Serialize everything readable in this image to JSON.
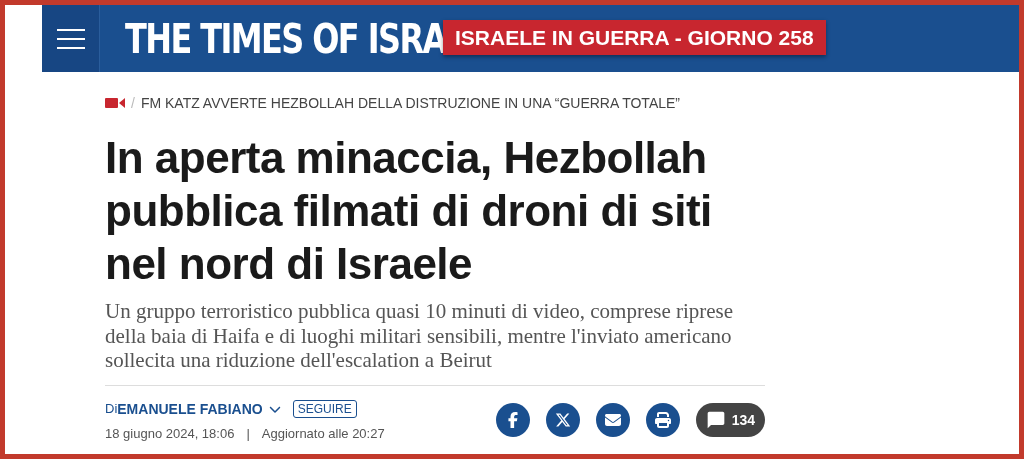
{
  "header": {
    "logo": "THE TIMES OF ISRA",
    "badge": "ISRAELE IN GUERRA - GIORNO 258"
  },
  "kicker": {
    "separator": "/",
    "text": "FM KATZ AVVERTE HEZBOLLAH DELLA DISTRUZIONE IN UNA “GUERRA TOTALE”"
  },
  "headline": "In aperta minaccia, Hezbollah pubblica filmati di droni di siti nel nord di Israele",
  "subtitle": "Un gruppo terroristico pubblica quasi 10 minuti di video, comprese riprese della baia di Haifa e di luoghi militari sensibili, mentre l'inviato americano sollecita una riduzione dell'escalation a Beirut",
  "byline": {
    "prefix": "Di",
    "author": "EMANUELE FABIANO",
    "follow": "SEGUIRE",
    "date": "18 giugno 2024, 18:06",
    "separator": "|",
    "updated": "Aggiornato alle 20:27"
  },
  "share": [
    {
      "kind": "facebook"
    },
    {
      "kind": "x"
    },
    {
      "kind": "email"
    },
    {
      "kind": "print"
    }
  ],
  "comments": {
    "count": "134"
  }
}
